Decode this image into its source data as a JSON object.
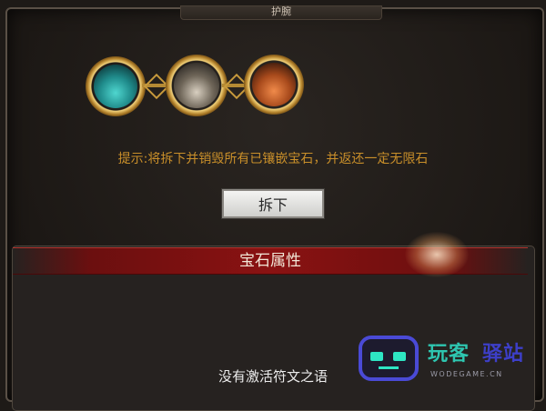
{
  "header": {
    "title": "护腕"
  },
  "sockets": [
    {
      "name": "teal-gem-slot",
      "gem_color": "#1f8a8a"
    },
    {
      "name": "grey-gem-slot",
      "gem_color": "#6e6558"
    },
    {
      "name": "orange-gem-slot",
      "gem_color": "#a84a1c"
    }
  ],
  "hint": "提示:将拆下并销毁所有已镶嵌宝石，并返还一定无限石",
  "remove_button": {
    "label": "拆下"
  },
  "gem_attributes": {
    "title": "宝石属性",
    "empty_text": "没有激活符文之语"
  },
  "watermark": {
    "brand_part1": "玩客",
    "brand_part2": "驿站",
    "domain": "WODEGAME.CN"
  },
  "colors": {
    "hint": "#c98f2a",
    "banner": "#8a1212",
    "gold": "#d6a848"
  }
}
